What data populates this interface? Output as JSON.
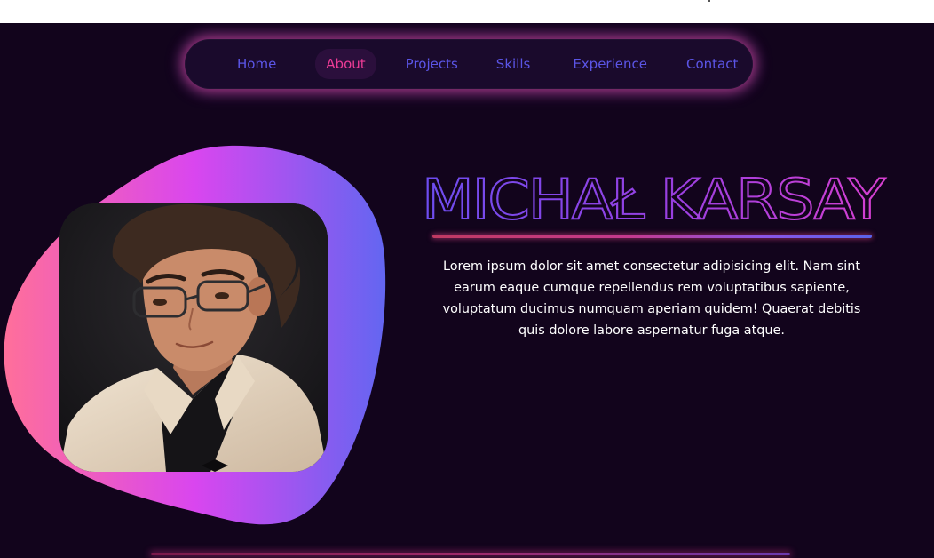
{
  "nav": {
    "items": [
      {
        "label": "Home",
        "active": false
      },
      {
        "label": "About",
        "active": true
      },
      {
        "label": "Projects",
        "active": false
      },
      {
        "label": "Skills",
        "active": false
      },
      {
        "label": "Experience",
        "active": false
      },
      {
        "label": "Contact",
        "active": false
      }
    ]
  },
  "hero": {
    "name": "MICHAŁ KARSAY",
    "description": "Lorem ipsum dolor sit amet consectetur adipisicing elit. Nam sint earum eaque cumque repellendus rem voluptatibus sapiente, voluptatum ducimus numquam aperiam quidem! Quaerat debitis quis dolore labore aspernatur fuga atque."
  },
  "colors": {
    "background": "#12041c",
    "nav_background": "#1a0a2c",
    "nav_link": "#5b55e6",
    "nav_active": "#ec3b95",
    "blob_gradient": [
      "#ff6f9a",
      "#d946ef",
      "#6366f1"
    ],
    "name_outline_gradient": [
      "#6d4df0",
      "#9a3fe0",
      "#d63fd0"
    ],
    "description_text": "#ffffff"
  }
}
